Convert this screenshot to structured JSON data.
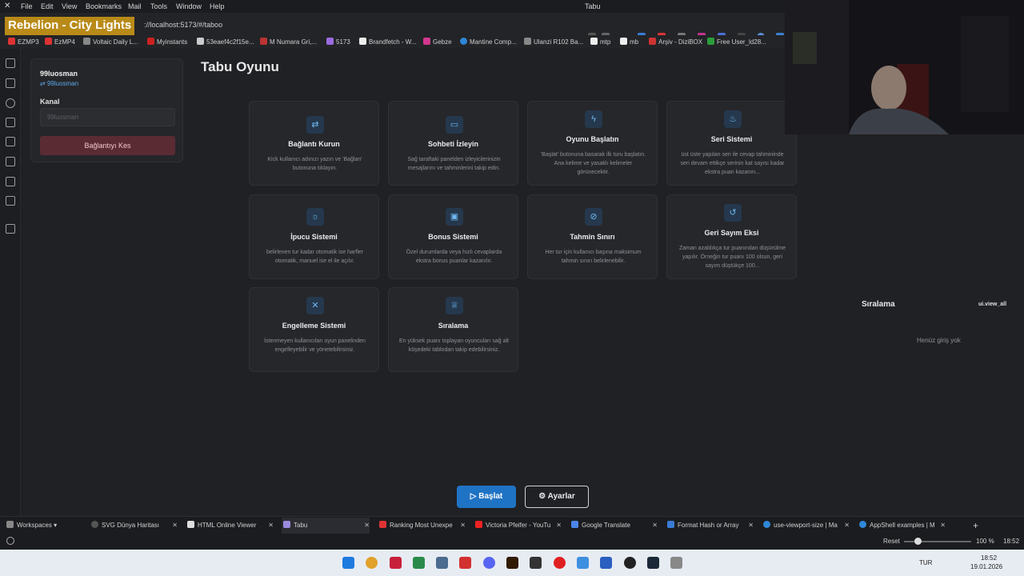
{
  "menu": [
    "File",
    "Edit",
    "View",
    "Bookmarks",
    "Mail",
    "Tools",
    "Window",
    "Help"
  ],
  "window_title": "Tabu",
  "overlay_title": "Rebelion - City Lights",
  "url": "://localhost:5173/#/taboo",
  "bookmarks": [
    "EZMP3",
    "EzMP4",
    "Voltaic Daily L...",
    "Myinstants",
    "53eaef4c2f15e...",
    "M Numara Gri,...",
    "5173",
    "Brandfetch - W...",
    "Gebze",
    "Mantine Comp...",
    "Ulanzi R102 Ba...",
    "mtp",
    "mb",
    "Arşiv - DiziBOX",
    "Free User_ld28..."
  ],
  "sidebar": {
    "username": "99luosman",
    "link": "99luosman",
    "channel_label": "Kanal",
    "channel_placeholder": "99luosman",
    "disconnect_label": "Bağlantıyı Kes"
  },
  "page_title": "Tabu Oyunu",
  "cards": [
    {
      "icon": "link-icon",
      "glyph": "⇄",
      "title": "Bağlantı Kurun",
      "desc": "Kick kullanıcı adınızı yazın ve 'Bağlan' butonuna tıklayın."
    },
    {
      "icon": "chat-icon",
      "glyph": "▭",
      "title": "Sohbeti İzleyin",
      "desc": "Sağ taraftaki panelden izleyicilerinizin mesajlarını ve tahminlerini takip edin."
    },
    {
      "icon": "bolt-icon",
      "glyph": "ϟ",
      "title": "Oyunu Başlatın",
      "desc": "'Başlat' butonuna basarak ilk turu başlatın. Ana kelime ve yasaklı kelimeler görünecektir."
    },
    {
      "icon": "flame-icon",
      "glyph": "♨",
      "title": "Seri Sistemi",
      "desc": "üst üste yapılan seri ile cevap tahmininde seri devam ettikçe serinin kat sayısı kadar ekstra puan kazanın..."
    },
    {
      "icon": "bulb-icon",
      "glyph": "☼",
      "title": "İpucu Sistemi",
      "desc": "belirlenen tur kadar otomatik ise harfler otomatik, manuel ise el ile açılır."
    },
    {
      "icon": "gift-icon",
      "glyph": "▣",
      "title": "Bonus Sistemi",
      "desc": "Özel durumlarda veya hızlı cevaplarda ekstra bonus puanlar kazanılır."
    },
    {
      "icon": "ban-icon",
      "glyph": "⊘",
      "title": "Tahmin Sınırı",
      "desc": "Her tur için kullanıcı başına maksimum tahmin sınırı belirlenebilir."
    },
    {
      "icon": "history-icon",
      "glyph": "↺",
      "title": "Geri Sayım Eksi",
      "desc": "Zaman azaldıkça tur puanından düşürülme yapılır. Örneğin tur puanı 100 olsun, geri sayım düştükçe 100..."
    },
    {
      "icon": "user-x-icon",
      "glyph": "✕",
      "title": "Engelleme Sistemi",
      "desc": "İstenmeyen kullanıcıları oyun panelinden engelleyebilir ve yönetebilirsiniz."
    },
    {
      "icon": "trophy-icon",
      "glyph": "♕",
      "title": "Sıralama",
      "desc": "En yüksek puanı toplayan oyuncuları sağ alt köşedeki tablodan takip edebilirsiniz."
    }
  ],
  "ranking": {
    "title": "Sıralama",
    "view_all": "ui.view_all",
    "empty": "Henüz giriş yok"
  },
  "actions": {
    "start": "Başlat",
    "settings": "Ayarlar"
  },
  "tabs": {
    "workspaces": "Workspaces",
    "items": [
      "SVG Dünya Haritası",
      "HTML Online Viewer",
      "Tabu",
      "Ranking Most Unexpe",
      "Victoria Pfeifer - YouTu",
      "Google Translate",
      "Format Hash or Array",
      "use-viewport-size | Ma",
      "AppShell examples | M"
    ]
  },
  "status": {
    "reset": "Reset",
    "zoom": "100 %",
    "time": "18:52"
  },
  "taskbar": {
    "lang": "TUR",
    "time": "18:52",
    "date": "19.01.2026"
  },
  "colors": {
    "accent": "#1f73c4",
    "danger_bg": "#5a2b33",
    "link": "#5aa9e8",
    "overlay": "#b88a18"
  }
}
